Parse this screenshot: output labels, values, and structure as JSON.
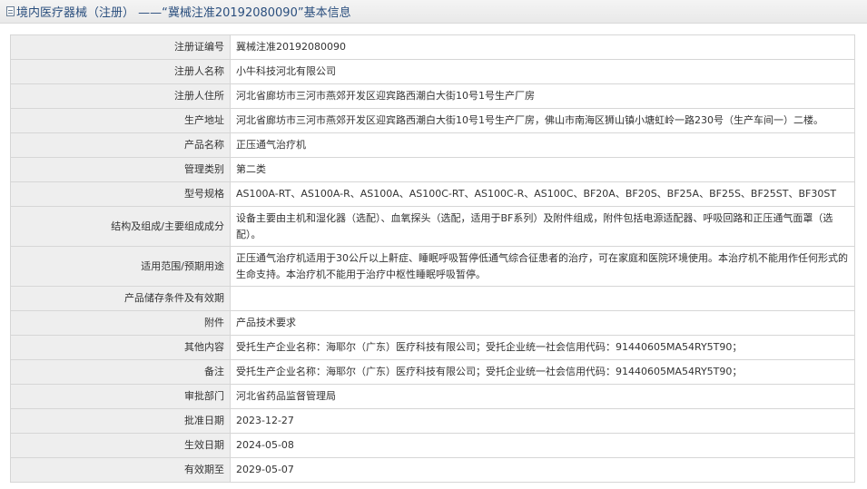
{
  "header": {
    "title": "境内医疗器械（注册） ——“冀械注准20192080090”基本信息"
  },
  "rows": [
    {
      "label": "注册证编号",
      "value": "冀械注准20192080090"
    },
    {
      "label": "注册人名称",
      "value": "小牛科技河北有限公司"
    },
    {
      "label": "注册人住所",
      "value": "河北省廊坊市三河市燕郊开发区迎宾路西潮白大街10号1号生产厂房"
    },
    {
      "label": "生产地址",
      "value": "河北省廊坊市三河市燕郊开发区迎宾路西潮白大街10号1号生产厂房，佛山市南海区狮山镇小塘虹岭一路230号（生产车间一）二楼。"
    },
    {
      "label": "产品名称",
      "value": "正压通气治疗机"
    },
    {
      "label": "管理类别",
      "value": "第二类"
    },
    {
      "label": "型号规格",
      "value": "AS100A-RT、AS100A-R、AS100A、AS100C-RT、AS100C-R、AS100C、BF20A、BF20S、BF25A、BF25S、BF25ST、BF30ST"
    },
    {
      "label": "结构及组成/主要组成成分",
      "value": "设备主要由主机和湿化器（选配）、血氧探头（选配，适用于BF系列）及附件组成，附件包括电源适配器、呼吸回路和正压通气面罩（选配）。"
    },
    {
      "label": "适用范围/预期用途",
      "value": "正压通气治疗机适用于30公斤以上鼾症、睡眠呼吸暂停低通气综合征患者的治疗，可在家庭和医院环境使用。本治疗机不能用作任何形式的生命支持。本治疗机不能用于治疗中枢性睡眠呼吸暂停。"
    },
    {
      "label": "产品储存条件及有效期",
      "value": ""
    },
    {
      "label": "附件",
      "value": "产品技术要求"
    },
    {
      "label": "其他内容",
      "value": "受托生产企业名称：海耶尔（广东）医疗科技有限公司；受托企业统一社会信用代码：91440605MA54RY5T90；"
    },
    {
      "label": "备注",
      "value": "受托生产企业名称：海耶尔（广东）医疗科技有限公司；受托企业统一社会信用代码：91440605MA54RY5T90；"
    },
    {
      "label": "审批部门",
      "value": "河北省药品监督管理局"
    },
    {
      "label": "批准日期",
      "value": "2023-12-27"
    },
    {
      "label": "生效日期",
      "value": "2024-05-08"
    },
    {
      "label": "有效期至",
      "value": "2029-05-07"
    }
  ]
}
